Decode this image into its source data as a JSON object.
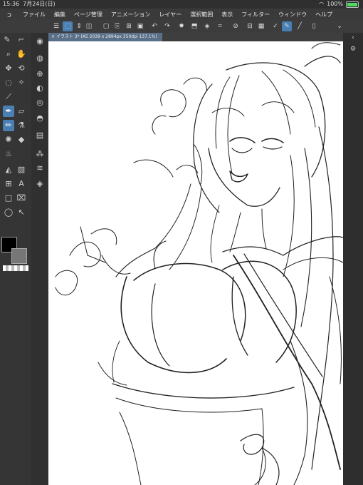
{
  "status": {
    "time": "15:36",
    "date": "7月24日(日)",
    "battery": "100%",
    "battery_level": 1.0
  },
  "menu": [
    "ファイル",
    "編集",
    "ページ管理",
    "アニメーション",
    "レイヤー",
    "選択範囲",
    "表示",
    "フィルター",
    "ウィンドウ",
    "ヘルプ"
  ],
  "document": {
    "tab_title": "イラスト 3* (A5 2039 x 2894px 350dpi 137.1%)"
  },
  "tools_left": [
    "brush-size-icon",
    "zoom-icon",
    "hand-icon",
    "move-icon",
    "rotate-icon",
    "lasso-icon",
    "magic-wand-icon",
    "eyedropper-icon",
    "pen-icon",
    "pencil-icon",
    "eraser-icon",
    "blend-icon",
    "fill-icon",
    "gradient-icon",
    "frame-icon",
    "text-icon",
    "balloon-icon",
    "ruler-icon",
    "shape-icon",
    "select-icon"
  ],
  "colors": {
    "main": "#000000",
    "sub": "#777777",
    "accent": "#4a7fb3"
  }
}
